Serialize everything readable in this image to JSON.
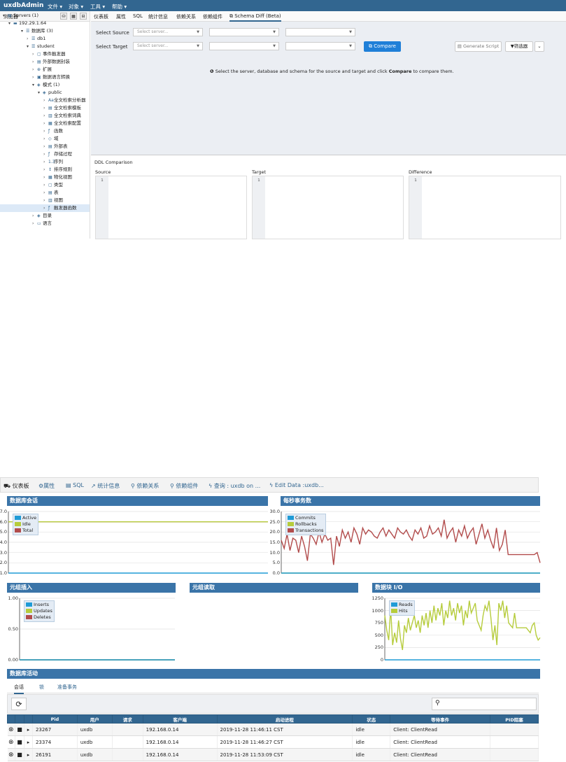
{
  "app": {
    "brand": "uxdbAdmin",
    "menu": [
      "文件 ▾",
      "对象 ▾",
      "工具 ▾",
      "帮助 ▾"
    ]
  },
  "browser": {
    "title": "浏览器",
    "tree": [
      {
        "label": "Servers (1)",
        "arrow": "▾",
        "icon": "▤"
      },
      {
        "label": "192.29.1.64",
        "arrow": "▾",
        "icon": "▬"
      },
      {
        "label": "数据库 (3)",
        "arrow": "▾",
        "icon": "☰"
      },
      {
        "label": "db1",
        "arrow": "›",
        "icon": "☰"
      },
      {
        "label": "student",
        "arrow": "▾",
        "icon": "☰"
      },
      {
        "label": "事件触发器",
        "arrow": "›",
        "icon": "▢"
      },
      {
        "label": "外部数据封装",
        "arrow": "›",
        "icon": "▤"
      },
      {
        "label": "扩展",
        "arrow": "›",
        "icon": "⊕"
      },
      {
        "label": "数据语言转换",
        "arrow": "›",
        "icon": "▣"
      },
      {
        "label": "模式 (1)",
        "arrow": "▾",
        "icon": "◈"
      },
      {
        "label": "public",
        "arrow": "▾",
        "icon": "◈"
      },
      {
        "label": "全文检索分析器",
        "arrow": "›",
        "icon": "Aa"
      },
      {
        "label": "全文检索模板",
        "arrow": "›",
        "icon": "▤"
      },
      {
        "label": "全文检索词典",
        "arrow": "›",
        "icon": "▥"
      },
      {
        "label": "全文检索配置",
        "arrow": "›",
        "icon": "▦"
      },
      {
        "label": "函数",
        "arrow": "›",
        "icon": "ƒ"
      },
      {
        "label": "域",
        "arrow": "›",
        "icon": "◇"
      },
      {
        "label": "外部表",
        "arrow": "›",
        "icon": "▤"
      },
      {
        "label": "存储过程",
        "arrow": "›",
        "icon": "ƒ"
      },
      {
        "label": "序列",
        "arrow": "›",
        "icon": "1.3"
      },
      {
        "label": "排序规则",
        "arrow": "›",
        "icon": "↕"
      },
      {
        "label": "物化视图",
        "arrow": "›",
        "icon": "▦"
      },
      {
        "label": "类型",
        "arrow": "›",
        "icon": "▢"
      },
      {
        "label": "表",
        "arrow": "›",
        "icon": "▤"
      },
      {
        "label": "视图",
        "arrow": "›",
        "icon": "▥"
      },
      {
        "label": "触发器函数",
        "arrow": "›",
        "icon": "ƒ"
      },
      {
        "label": "目录",
        "arrow": "›",
        "icon": "◈"
      },
      {
        "label": "语言",
        "arrow": "›",
        "icon": "▭"
      }
    ]
  },
  "tabs": [
    {
      "label": "仪表板"
    },
    {
      "label": "属性"
    },
    {
      "label": "SQL"
    },
    {
      "label": "统计信息"
    },
    {
      "label": "依赖关系"
    },
    {
      "label": "依赖组件"
    },
    {
      "label": "Schema Diff (Beta)"
    }
  ],
  "schema_diff": {
    "select_source_label": "Select Source",
    "select_target_label": "Select Target",
    "server_placeholder": "Select server...",
    "compare_label": "Compare",
    "generate_script_label": "Generate Script",
    "filter_label": "筛选器",
    "message_pre": "Select the server, database and schema for the source and target and click ",
    "message_bold": "Compare",
    "message_post": " to compare them."
  },
  "ddl": {
    "title": "DDL Comparison",
    "source_label": "Source",
    "target_label": "Target",
    "difference_label": "Difference",
    "line_number": "1"
  },
  "dashboard": {
    "tabs": [
      {
        "icon": "⛟",
        "label": "仪表板"
      },
      {
        "icon": "⚙",
        "label": "属性"
      },
      {
        "icon": "▤",
        "label": "SQL"
      },
      {
        "icon": "↗",
        "label": "统计信息"
      },
      {
        "icon": "⚲",
        "label": "依赖关系"
      },
      {
        "icon": "⚲",
        "label": "依赖组件"
      },
      {
        "icon": "ϟ",
        "label": "查询 : uxdb on ..."
      },
      {
        "icon": "ϟ",
        "label": "Edit Data :uxdb..."
      }
    ],
    "sessions_title": "数据库会话",
    "tps_title": "每秒事务数",
    "tuples_in_title": "元组插入",
    "tuples_out_title": "元组读取",
    "blocks_title": "数据块 I/O",
    "activity_title": "数据库活动",
    "subtabs": [
      "会话",
      "锁",
      "准备事务"
    ],
    "search_placeholder": "",
    "table": {
      "headers": [
        "",
        "",
        "",
        "Pid",
        "用户",
        "请求",
        "客户端",
        "启动进程",
        "状态",
        "等待事件",
        "PID阻塞"
      ],
      "rows": [
        {
          "pid": "23267",
          "user": "uxdb",
          "request": "",
          "client": "192.168.0.14",
          "start": "2019-11-28 11:46:11 CST",
          "state": "idle",
          "wait": "Client: ClientRead",
          "blocking": ""
        },
        {
          "pid": "23374",
          "user": "uxdb",
          "request": "",
          "client": "192.168.0.14",
          "start": "2019-11-28 11:46:27 CST",
          "state": "idle",
          "wait": "Client: ClientRead",
          "blocking": ""
        },
        {
          "pid": "26191",
          "user": "uxdb",
          "request": "",
          "client": "192.168.0.14",
          "start": "2019-11-28 11:53:09 CST",
          "state": "idle",
          "wait": "Client: ClientRead",
          "blocking": ""
        }
      ]
    }
  },
  "colors": {
    "nav": "#326690",
    "active": "#1f9bd6",
    "idle": "#b6cc3c",
    "total": "#b24c4c",
    "panel_header": "#3a74a8"
  },
  "chart_data": [
    {
      "type": "line",
      "title": "数据库会话",
      "ylim": [
        1.0,
        7.0
      ],
      "yticks": [
        "1.0",
        "2.0",
        "3.0",
        "4.0",
        "5.0",
        "6.0",
        "7.0"
      ],
      "legend_position": "top-left",
      "series": [
        {
          "name": "Active",
          "color": "#1f9bd6",
          "values": [
            1,
            1,
            1,
            1,
            1,
            1,
            1,
            1,
            1,
            1,
            1,
            1,
            1,
            1,
            1,
            1,
            1,
            1,
            1,
            1,
            1,
            1,
            1,
            1,
            1,
            1,
            1,
            1,
            1,
            1
          ]
        },
        {
          "name": "Idle",
          "color": "#b6cc3c",
          "values": [
            6,
            6,
            6,
            6,
            6,
            6,
            6,
            6,
            6,
            6,
            6,
            6,
            6,
            6,
            6,
            6,
            6,
            6,
            6,
            6,
            6,
            6,
            6,
            6,
            6,
            6,
            6,
            6,
            6,
            6
          ]
        },
        {
          "name": "Total",
          "color": "#b24c4c",
          "values": [
            6,
            6,
            6,
            6,
            6,
            6,
            6,
            6,
            6,
            6,
            6,
            6,
            6,
            6,
            6,
            6,
            6,
            6,
            6,
            6,
            6,
            6,
            6,
            6,
            6,
            6,
            6,
            6,
            6,
            6
          ]
        }
      ]
    },
    {
      "type": "line",
      "title": "每秒事务数",
      "ylim": [
        0.0,
        30.0
      ],
      "yticks": [
        "0.0",
        "5.0",
        "10.0",
        "15.0",
        "20.0",
        "25.0",
        "30.0"
      ],
      "legend_position": "top-left",
      "series": [
        {
          "name": "Commits",
          "color": "#1f9bd6",
          "values": [
            0,
            0,
            0,
            0,
            0,
            0,
            0,
            0,
            0,
            0,
            0,
            0,
            0,
            0,
            0,
            0,
            0,
            0,
            0,
            0,
            0,
            0,
            0,
            0,
            0,
            0,
            0,
            0,
            0,
            0,
            0,
            0,
            0,
            0,
            0,
            0,
            0,
            0,
            0,
            0,
            0,
            0,
            0,
            0,
            0,
            0,
            0,
            0,
            0,
            0,
            0,
            0,
            0,
            0,
            0,
            0,
            0,
            0,
            0,
            0,
            0,
            0,
            0,
            0,
            0,
            0,
            0,
            0,
            0,
            0,
            0,
            0,
            0,
            0,
            0,
            0,
            0,
            0,
            0,
            0,
            0,
            0,
            0,
            0,
            0,
            0,
            0,
            0,
            0,
            0
          ]
        },
        {
          "name": "Rollbacks",
          "color": "#b6cc3c",
          "values": [
            0,
            0,
            0,
            0,
            0,
            0,
            0,
            0,
            0,
            0,
            0,
            0,
            0,
            0,
            0,
            0,
            0,
            0,
            0,
            0,
            0,
            0,
            0,
            0,
            0,
            0,
            0,
            0,
            0,
            0,
            0,
            0,
            0,
            0,
            0,
            0,
            0,
            0,
            0,
            0,
            0,
            0,
            0,
            0,
            0,
            0,
            0,
            0,
            0,
            0,
            0,
            0,
            0,
            0,
            0,
            0,
            0,
            0,
            0,
            0,
            0,
            0,
            0,
            0,
            0,
            0,
            0,
            0,
            0,
            0,
            0,
            0,
            0,
            0,
            0,
            0,
            0,
            0,
            0,
            0,
            0,
            0,
            0,
            0,
            0,
            0,
            0,
            0,
            0,
            0
          ]
        },
        {
          "name": "Transactions",
          "color": "#b24c4c",
          "values": [
            16,
            12,
            19,
            11,
            17,
            16,
            10,
            18,
            13,
            6,
            19,
            17,
            14,
            20,
            15,
            19,
            16,
            17,
            4,
            18,
            13,
            21,
            17,
            20,
            15,
            22,
            19,
            14,
            22,
            19,
            21,
            20,
            18,
            17,
            20,
            22,
            18,
            21,
            19,
            17,
            22,
            20,
            19,
            21,
            18,
            16,
            21,
            19,
            22,
            17,
            18,
            23,
            19,
            20,
            22,
            18,
            26,
            17,
            20,
            22,
            15,
            21,
            18,
            23,
            17,
            20,
            22,
            14,
            19,
            24,
            17,
            21,
            16,
            12,
            22,
            11,
            14,
            21,
            9,
            9,
            9,
            9,
            9,
            9,
            9,
            9,
            9,
            9,
            10,
            5
          ]
        }
      ]
    },
    {
      "type": "line",
      "title": "元组插入",
      "ylim": [
        0.0,
        1.0
      ],
      "yticks": [
        "0.00",
        "0.50",
        "1.00"
      ],
      "legend_position": "top-left",
      "series": [
        {
          "name": "Inserts",
          "color": "#1f9bd6",
          "values": [
            0,
            0,
            0,
            0,
            0,
            0,
            0,
            0,
            0,
            0,
            0,
            0,
            0,
            0,
            0,
            0,
            0,
            0,
            0,
            0
          ]
        },
        {
          "name": "Updates",
          "color": "#b6cc3c",
          "values": [
            0,
            0,
            0,
            0,
            0,
            0,
            0,
            0,
            0,
            0,
            0,
            0,
            0,
            0,
            0,
            0,
            0,
            0,
            0,
            0
          ]
        },
        {
          "name": "Deletes",
          "color": "#b24c4c",
          "values": [
            0,
            0,
            0,
            0,
            0,
            0,
            0,
            0,
            0,
            0,
            0,
            0,
            0,
            0,
            0,
            0,
            0,
            0,
            0,
            0
          ]
        }
      ]
    },
    {
      "type": "line",
      "title": "数据块 I/O",
      "ylim": [
        0,
        1250
      ],
      "yticks": [
        "0",
        "250",
        "500",
        "750",
        "1000",
        "1250"
      ],
      "legend_position": "top-left",
      "series": [
        {
          "name": "Reads",
          "color": "#1f9bd6",
          "values": [
            0,
            0,
            0,
            0,
            0,
            0,
            0,
            0,
            0,
            0,
            0,
            0,
            0,
            0,
            0,
            0,
            0,
            0,
            0,
            0,
            0,
            0,
            0,
            0,
            0,
            0,
            0,
            0,
            0,
            0,
            0,
            0,
            0,
            0,
            0,
            0,
            0,
            0,
            0,
            0,
            0,
            0,
            0,
            0,
            0,
            0,
            0,
            0,
            0,
            0,
            0,
            0,
            0,
            0,
            0,
            0,
            0,
            0,
            0,
            0,
            0,
            0,
            0,
            0,
            0,
            0,
            0,
            0,
            0,
            0,
            0,
            0,
            0,
            0,
            0,
            0,
            0,
            0,
            0,
            0
          ]
        },
        {
          "name": "Hits",
          "color": "#b6cc3c",
          "values": [
            900,
            600,
            400,
            1050,
            300,
            550,
            350,
            800,
            420,
            200,
            700,
            550,
            850,
            600,
            750,
            900,
            650,
            800,
            550,
            900,
            700,
            950,
            650,
            1000,
            750,
            1100,
            800,
            1050,
            900,
            1150,
            700,
            1000,
            850,
            1200,
            900,
            1050,
            800,
            1150,
            950,
            1100,
            700,
            1000,
            850,
            1200,
            950,
            1050,
            1150,
            800,
            700,
            600,
            900,
            1100,
            1000,
            1200,
            850,
            400,
            700,
            300,
            1150,
            1000,
            1200,
            850,
            1100,
            750,
            700,
            650,
            950,
            650,
            650,
            650,
            650,
            650,
            650,
            600,
            550,
            700,
            750,
            500,
            400,
            450
          ]
        }
      ]
    }
  ]
}
